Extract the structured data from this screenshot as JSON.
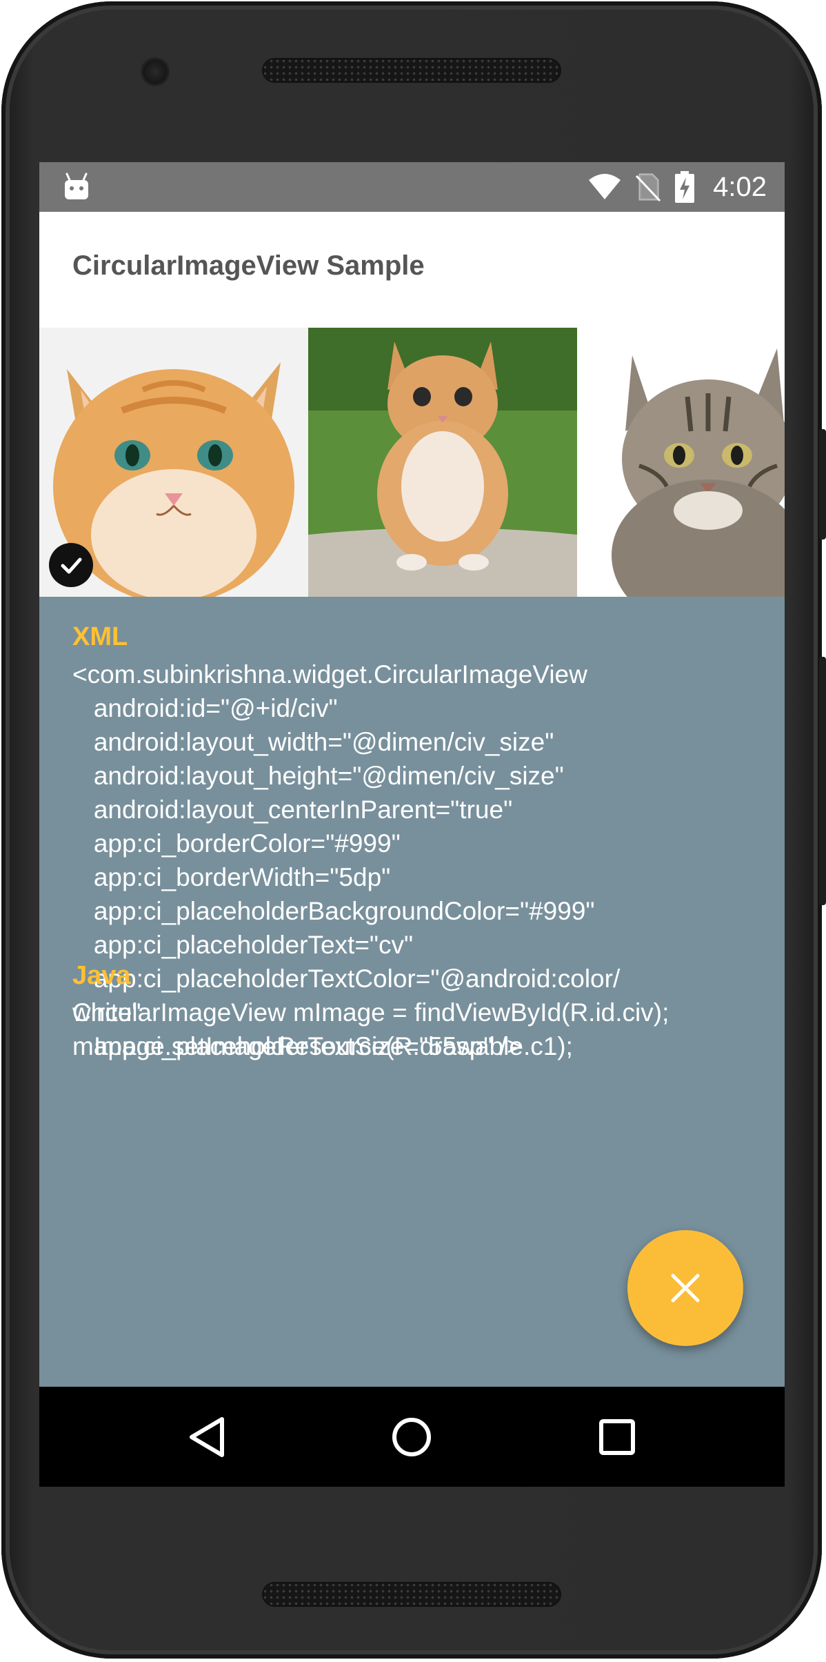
{
  "status_bar": {
    "time": "4:02",
    "icons": [
      "android-debug-icon",
      "wifi-icon",
      "no-sim-icon",
      "battery-charging-icon"
    ]
  },
  "app_bar": {
    "title": "CircularImageView Sample"
  },
  "gallery": {
    "items": [
      {
        "name": "orange-kitten-closeup",
        "selected": true
      },
      {
        "name": "orange-kitten-grass",
        "selected": false
      },
      {
        "name": "tabby-cat",
        "selected": false
      }
    ]
  },
  "xml_section": {
    "label": "XML",
    "code": "<com.subinkrishna.widget.CircularImageView\n   android:id=\"@+id/civ\"\n   android:layout_width=\"@dimen/civ_size\"\n   android:layout_height=\"@dimen/civ_size\"\n   android:layout_centerInParent=\"true\"\n   app:ci_borderColor=\"#999\"\n   app:ci_borderWidth=\"5dp\"\n   app:ci_placeholderBackgroundColor=\"#999\"\n   app:ci_placeholderText=\"cv\"\n   app:ci_placeholderTextColor=\"@android:color/\nwhite\"\n   app:ci_placeholderTextSize=\"55sp\" />"
  },
  "java_section": {
    "label": "Java",
    "code": "CircularImageView mImage = findViewById(R.id.civ);\nmImage.setImageResource(R.drawable.c1);"
  },
  "fab": {
    "icon": "close-icon"
  },
  "nav_bar": {
    "buttons": [
      "back-icon",
      "home-icon",
      "recents-icon"
    ]
  },
  "colors": {
    "accent": "#fbbd38",
    "section_label": "#ffc033",
    "content_bg": "#78909c",
    "status_bar": "#757575"
  }
}
